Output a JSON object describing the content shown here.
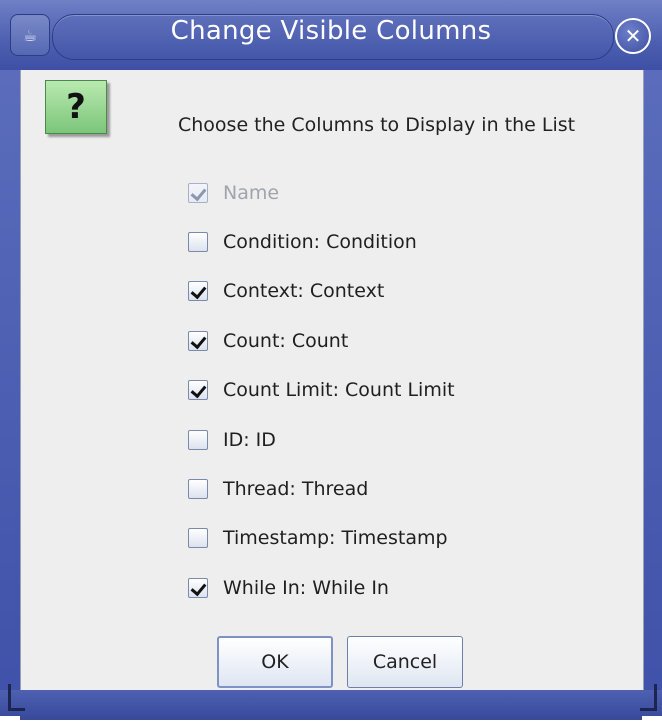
{
  "window": {
    "title": "Change Visible Columns",
    "close_symbol": "✕",
    "app_icon": "java-cup-icon",
    "colors": {
      "titlebar": "#4d5fb0",
      "content": "#eeeeee",
      "prompt_icon": "#8fd08a"
    }
  },
  "dialog": {
    "prompt_icon_glyph": "?",
    "prompt_icon": "question-icon",
    "prompt": "Choose the Columns to Display in the List",
    "columns": [
      {
        "label": "Name",
        "checked": true,
        "enabled": false
      },
      {
        "label": "Condition: Condition",
        "checked": false,
        "enabled": true
      },
      {
        "label": "Context: Context",
        "checked": true,
        "enabled": true
      },
      {
        "label": "Count: Count",
        "checked": true,
        "enabled": true
      },
      {
        "label": "Count Limit: Count Limit",
        "checked": true,
        "enabled": true
      },
      {
        "label": "ID: ID",
        "checked": false,
        "enabled": true
      },
      {
        "label": "Thread: Thread",
        "checked": false,
        "enabled": true
      },
      {
        "label": "Timestamp: Timestamp",
        "checked": false,
        "enabled": true
      },
      {
        "label": "While In: While In",
        "checked": true,
        "enabled": true
      }
    ]
  },
  "buttons": {
    "ok": "OK",
    "cancel": "Cancel"
  }
}
